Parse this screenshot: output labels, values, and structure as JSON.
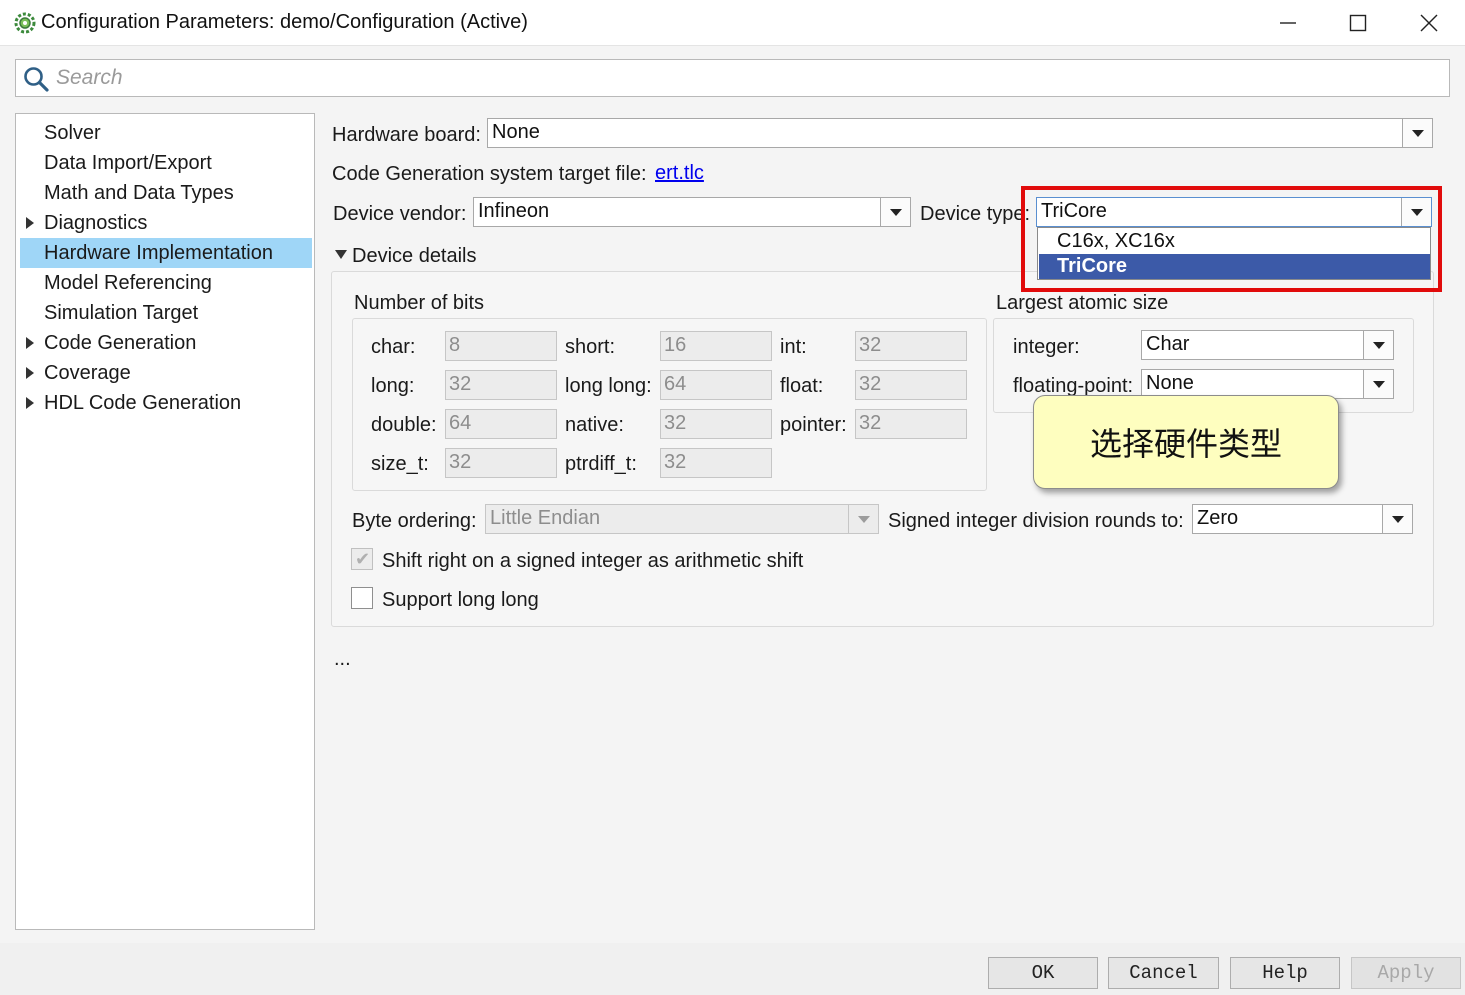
{
  "window": {
    "title": "Configuration Parameters: demo/Configuration (Active)",
    "icon": "gear-icon"
  },
  "search": {
    "placeholder": "Search"
  },
  "tree": {
    "items": [
      {
        "label": "Solver",
        "expandable": false,
        "selected": false
      },
      {
        "label": "Data Import/Export",
        "expandable": false,
        "selected": false
      },
      {
        "label": "Math and Data Types",
        "expandable": false,
        "selected": false
      },
      {
        "label": "Diagnostics",
        "expandable": true,
        "selected": false
      },
      {
        "label": "Hardware Implementation",
        "expandable": false,
        "selected": true
      },
      {
        "label": "Model Referencing",
        "expandable": false,
        "selected": false
      },
      {
        "label": "Simulation Target",
        "expandable": false,
        "selected": false
      },
      {
        "label": "Code Generation",
        "expandable": true,
        "selected": false
      },
      {
        "label": "Coverage",
        "expandable": true,
        "selected": false
      },
      {
        "label": "HDL Code Generation",
        "expandable": true,
        "selected": false
      }
    ]
  },
  "hardware": {
    "board_label": "Hardware board:",
    "board_value": "None",
    "target_label": "Code Generation system target file:",
    "target_link": "ert.tlc",
    "vendor_label": "Device vendor:",
    "vendor_value": "Infineon",
    "type_label": "Device type:",
    "type_value": "TriCore",
    "type_options": [
      "C16x, XC16x",
      "TriCore"
    ],
    "type_selected_index": 1
  },
  "details": {
    "header": "Device details",
    "bits_title": "Number of bits",
    "bits": {
      "char_label": "char:",
      "char": "8",
      "short_label": "short:",
      "short": "16",
      "int_label": "int:",
      "int": "32",
      "long_label": "long:",
      "long": "32",
      "longlong_label": "long long:",
      "longlong": "64",
      "float_label": "float:",
      "float": "32",
      "double_label": "double:",
      "double": "64",
      "native_label": "native:",
      "native": "32",
      "pointer_label": "pointer:",
      "pointer": "32",
      "sizet_label": "size_t:",
      "sizet": "32",
      "ptrdiff_label": "ptrdiff_t:",
      "ptrdiff": "32"
    },
    "atomic_title": "Largest atomic size",
    "atomic": {
      "integer_label": "integer:",
      "integer_value": "Char",
      "float_label": "floating-point:",
      "float_value": "None"
    },
    "byte_order_label": "Byte ordering:",
    "byte_order_value": "Little Endian",
    "div_round_label": "Signed integer division rounds to:",
    "div_round_value": "Zero",
    "shift_label": "Shift right on a signed integer as arithmetic shift",
    "shift_checked": true,
    "longlong_support_label": "Support long long",
    "longlong_support_checked": false
  },
  "ellipsis": "...",
  "annotation": {
    "text": "选择硬件类型"
  },
  "buttons": {
    "ok": "OK",
    "cancel": "Cancel",
    "help": "Help",
    "apply": "Apply"
  },
  "colors": {
    "selection": "#9fd6f7",
    "dropdown_highlight": "#3c5aa8",
    "annotation_border": "#e10b0b",
    "callout_fill": "#fefebf",
    "link": "#0000ee"
  }
}
